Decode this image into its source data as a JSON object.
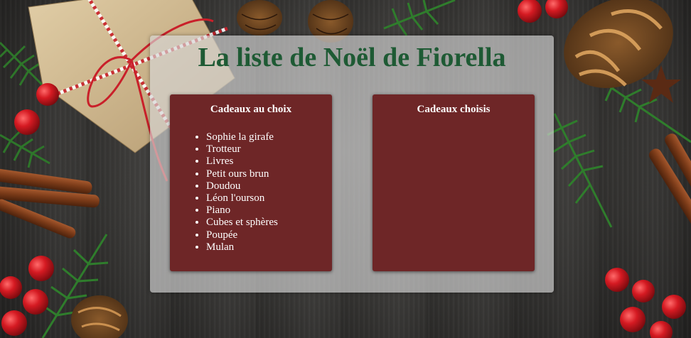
{
  "page": {
    "title": "La liste de Noël de Fiorella"
  },
  "lists": {
    "available": {
      "heading": "Cadeaux au choix",
      "items": [
        "Sophie la girafe",
        "Trotteur",
        "Livres",
        "Petit ours brun",
        "Doudou",
        "Léon l'ourson",
        "Piano",
        "Cubes et sphères",
        "Poupée",
        "Mulan"
      ]
    },
    "chosen": {
      "heading": "Cadeaux choisis",
      "items": []
    }
  },
  "colors": {
    "title_green": "#1e5a34",
    "box_red": "#6e2627",
    "panel": "#d6d6d6",
    "berry_red": "#c8141c",
    "fir_green": "#2f7a2c"
  }
}
